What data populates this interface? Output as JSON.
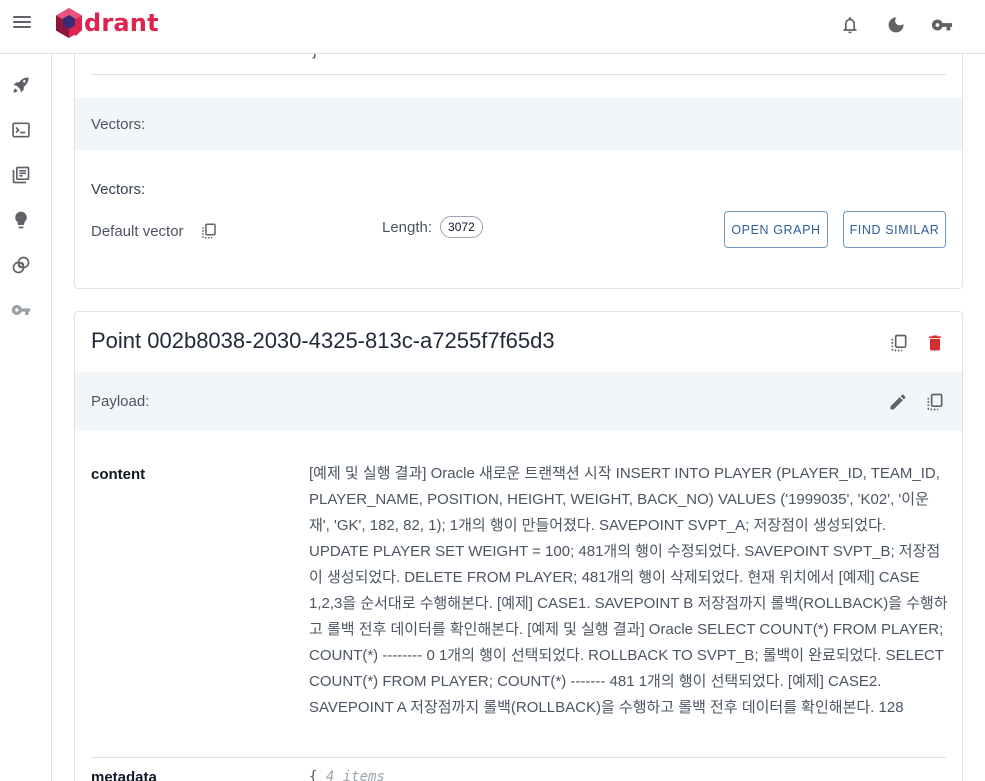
{
  "app": {
    "logo_text": "drant",
    "brand_color": "#dc244c"
  },
  "topbar": {
    "icons": [
      "menu-icon",
      "bell-icon",
      "moon-icon",
      "key-icon"
    ]
  },
  "sidebar": {
    "items": [
      "rocket-icon",
      "terminal-icon",
      "collections-icon",
      "lightbulb-icon",
      "datasets-icon",
      "key-icon"
    ]
  },
  "card1": {
    "closing_brace": "}",
    "vectors_band_label": "Vectors:",
    "vectors_title": "Vectors:",
    "vector_name": "Default vector",
    "length_label": "Length:",
    "length_value": "3072",
    "open_graph_label": "OPEN GRAPH",
    "find_similar_label": "FIND SIMILAR"
  },
  "card2": {
    "point_title": "Point 002b8038-2030-4325-813c-a7255f7f65d3",
    "payload_label": "Payload:",
    "fields": [
      {
        "key": "content",
        "value": "[예제 및 실행 결과] Oracle 새로운 트랜잭션 시작 INSERT INTO PLAYER (PLAYER_ID, TEAM_ID, PLAYER_NAME, POSITION, HEIGHT, WEIGHT, BACK_NO) VALUES ('1999035', 'K02', '이운재', 'GK', 182, 82, 1); 1개의 행이 만들어졌다. SAVEPOINT SVPT_A; 저장점이 생성되었다. UPDATE PLAYER SET WEIGHT = 100; 481개의 행이 수정되었다. SAVEPOINT SVPT_B; 저장점이 생성되었다. DELETE FROM PLAYER; 481개의 행이 삭제되었다. 현재 위치에서 [예제] CASE 1,2,3을 순서대로 수행해본다. [예제] CASE1. SAVEPOINT B 저장점까지 롤백(ROLLBACK)을 수행하고 롤백 전후 데이터를 확인해본다. [예제 및 실행 결과] Oracle SELECT COUNT(*) FROM PLAYER; COUNT(*) -------- 0 1개의 행이 선택되었다. ROLLBACK TO SVPT_B; 롤백이 완료되었다. SELECT COUNT(*) FROM PLAYER; COUNT(*) ------- 481 1개의 행이 선택되었다. [예제] CASE2. SAVEPOINT A 저장점까지 롤백(ROLLBACK)을 수행하고 롤백 전후 데이터를 확인해본다. 128"
      },
      {
        "key": "metadata",
        "value_prefix": "{",
        "value_hint": "4 items"
      }
    ]
  }
}
